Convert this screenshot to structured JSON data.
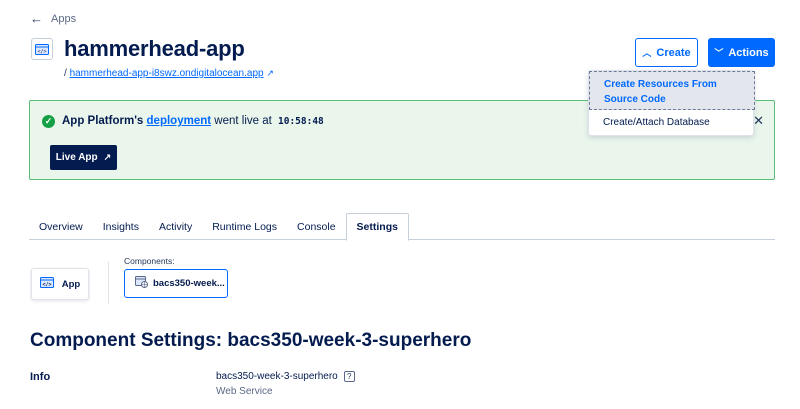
{
  "breadcrumb": {
    "back_label": "Apps"
  },
  "header": {
    "title": "hammerhead-app",
    "url_prefix": "/",
    "url_text": "hammerhead-app-i8swz.ondigitalocean.app",
    "create_label": "Create",
    "actions_label": "Actions"
  },
  "create_menu": {
    "item1_line1": "Create Resources From",
    "item1_line2": "Source Code",
    "item2": "Create/Attach Database"
  },
  "banner": {
    "prefix": "App Platform's",
    "link": "deployment",
    "suffix": "went live at",
    "time": "10:58:48",
    "live_button": "Live App"
  },
  "tabs": [
    {
      "label": "Overview"
    },
    {
      "label": "Insights"
    },
    {
      "label": "Activity"
    },
    {
      "label": "Runtime Logs"
    },
    {
      "label": "Console"
    },
    {
      "label": "Settings",
      "active": true
    }
  ],
  "components": {
    "app_label": "App",
    "components_label": "Components:",
    "selected_component": "bacs350-week..."
  },
  "settings": {
    "title": "Component Settings: bacs350-week-3-superhero",
    "info_label": "Info",
    "component_name": "bacs350-week-3-superhero",
    "help_mark": "?",
    "component_type": "Web Service"
  },
  "colors": {
    "brand_blue": "#0069ff",
    "navy": "#031b4e",
    "success_green": "#15a046",
    "banner_bg": "#eaf6ec"
  }
}
